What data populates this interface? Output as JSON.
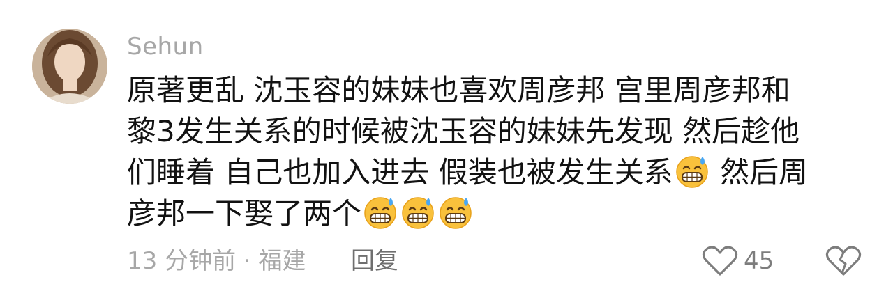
{
  "comment": {
    "username": "Sehun",
    "text_lines": [
      "原著更乱 沈玉容的妹妹也喜欢周彦邦 宫里周彦邦和",
      "黎3发生关系的时候被沈玉容的妹妹先发现 然后趁他",
      "们睡着 自己也加入进去 假装也被发生关系",
      "然后周",
      "彦邦一下娶了两个"
    ],
    "emoji_name": "grinning-sweat-emoji",
    "meta": "13 分钟前 · 福建",
    "reply_label": "回复",
    "like_count": "45",
    "icons": {
      "like": "heart-outline-icon",
      "dislike": "broken-heart-icon"
    },
    "colors": {
      "text": "#121212",
      "muted": "#a7a7a7",
      "emoji": "#f7b733"
    }
  }
}
